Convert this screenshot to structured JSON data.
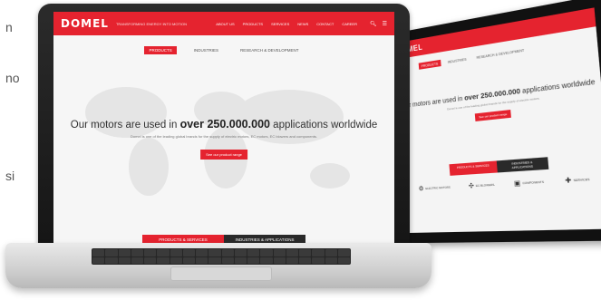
{
  "side_text": [
    "n",
    "no",
    "si"
  ],
  "laptop": {
    "logo": "DOMEL",
    "tagline": "TRANSFORMING ENERGY INTO MOTION",
    "nav": [
      "ABOUT US",
      "PRODUCTS",
      "SERVICES",
      "NEWS",
      "CONTACT",
      "CAREER"
    ],
    "tabs": [
      {
        "label": "PRODUCTS",
        "active": true
      },
      {
        "label": "INDUSTRIES",
        "active": false
      },
      {
        "label": "RESEARCH & DEVELOPMENT",
        "active": false
      }
    ],
    "headline_pre": "Our motors are used in",
    "headline_bold": "over 250.000.000",
    "headline_post": "applications worldwide",
    "subline": "Domel is one of the leading global brands for the supply of electric motors, EC motors, EC blowers and components.",
    "cta": "See our product range",
    "bottom_tabs": [
      "PRODUCTS & SERVICES",
      "INDUSTRIES & APPLICATIONS"
    ]
  },
  "tablet": {
    "logo": "DOMEL",
    "tabs": [
      {
        "label": "PRODUCTS",
        "active": true
      },
      {
        "label": "INDUSTRIES",
        "active": false
      },
      {
        "label": "RESEARCH & DEVELOPMENT",
        "active": false
      }
    ],
    "headline_pre": "Our motors are used in",
    "headline_bold": "over 250.000.000",
    "headline_post": "applications worldwide",
    "subline": "Domel is one of the leading global brands for the supply of electric motors.",
    "cta": "See our product range",
    "bottom_tabs": [
      "PRODUCTS & SERVICES",
      "INDUSTRIES & APPLICATIONS"
    ],
    "icons": [
      {
        "icon": "gear-icon",
        "label": "ELECTRIC MOTORS"
      },
      {
        "icon": "fan-icon",
        "label": "EC BLOWERS"
      },
      {
        "icon": "component-icon",
        "label": "COMPONENTS"
      },
      {
        "icon": "tool-icon",
        "label": "SERVICES"
      }
    ]
  },
  "colors": {
    "brand_red": "#e5232f",
    "dark": "#2a2a2a"
  }
}
